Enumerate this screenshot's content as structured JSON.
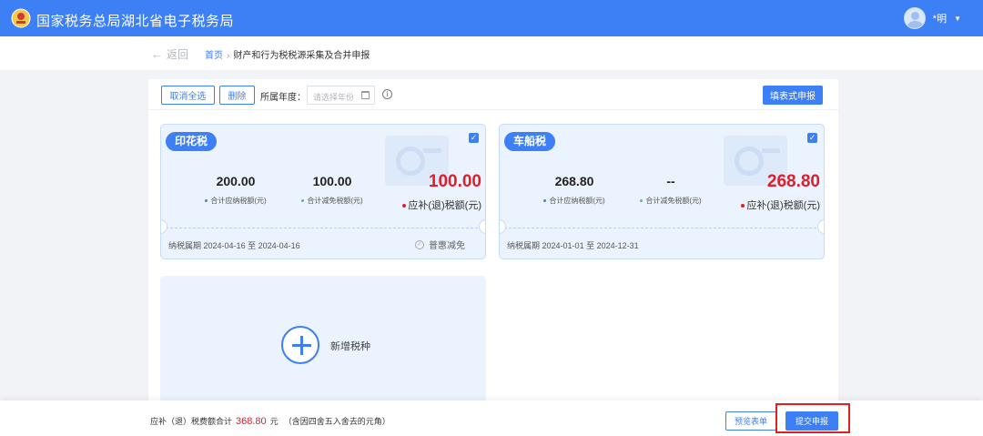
{
  "header": {
    "site_title": "国家税务总局湖北省电子税务局",
    "user_name": "*明",
    "brand_color": "#3d7ff5"
  },
  "breadcrumb": {
    "back_label": "返回",
    "home": "首页",
    "separator": "›",
    "current": "财产和行为税税源采集及合并申报"
  },
  "toolbar": {
    "cancel_select_all": "取消全选",
    "delete": "删除",
    "year_label": "所属年度：",
    "year_placeholder": "请选择年份",
    "fill_form_report": "填表式申报"
  },
  "cards": [
    {
      "tax_name": "印花税",
      "checked": true,
      "payable_amount": "200.00",
      "payable_label": "合计应纳税额(元)",
      "relief_amount": "100.00",
      "relief_label": "合计减免税额(元)",
      "refund_amount": "100.00",
      "refund_label": "应补(退)税额(元)",
      "period_label": "纳税属期",
      "period": "2024-04-16 至 2024-04-16",
      "relief_option": "普惠减免"
    },
    {
      "tax_name": "车船税",
      "checked": true,
      "payable_amount": "268.80",
      "payable_label": "合计应纳税额(元)",
      "relief_amount": "--",
      "relief_label": "合计减免税额(元)",
      "refund_amount": "268.80",
      "refund_label": "应补(退)税额(元)",
      "period_label": "纳税属期",
      "period": "2024-01-01 至 2024-12-31"
    }
  ],
  "add_tax": {
    "label": "新增税种"
  },
  "footer": {
    "total_label": "应补（退）税费额合计",
    "total_amount": "368.80",
    "total_unit": "元",
    "total_note": "（含因四舍五入舍去的元角）",
    "preview_button": "预览表单",
    "submit_button": "提交申报"
  }
}
